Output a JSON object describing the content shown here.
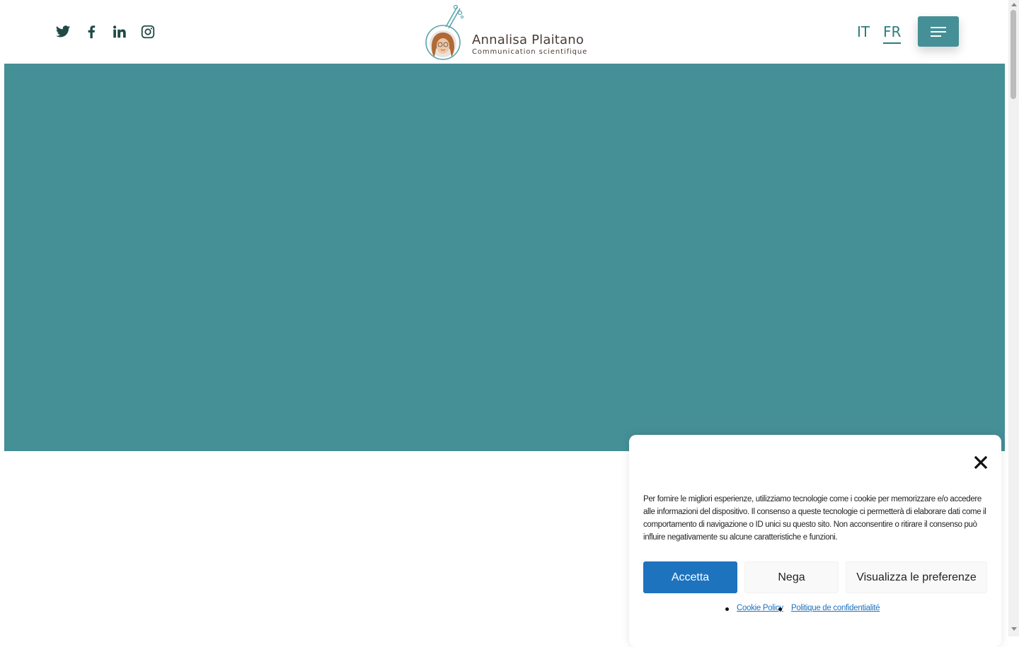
{
  "header": {
    "social": [
      {
        "icon": "twitter-icon"
      },
      {
        "icon": "facebook-icon"
      },
      {
        "icon": "linkedin-icon"
      },
      {
        "icon": "instagram-icon"
      }
    ],
    "logo": {
      "name": "Annalisa Plaitano",
      "tagline": "Communication scientifique"
    },
    "languages": [
      "IT",
      "FR"
    ],
    "active_language": "FR",
    "menu_icon": "hamburger-menu-icon"
  },
  "hero": {
    "background": "#458f96"
  },
  "cookie_banner": {
    "message": "Per fornire le migliori esperienze, utilizziamo tecnologie come i cookie per memorizzare e/o accedere alle informazioni del dispositivo. Il consenso a queste tecnologie ci permetterà di elaborare dati come il comportamento di navigazione o ID unici su questo sito. Non acconsentire o ritirare il consenso può influire negativamente su alcune caratteristiche e funzioni.",
    "accept_label": "Accetta",
    "deny_label": "Nega",
    "preferences_label": "Visualizza le preferenze",
    "links": [
      "Cookie Policy",
      "Politique de confidentialité"
    ],
    "close_icon": "close-icon"
  },
  "colors": {
    "brand_teal": "#458f96",
    "accept_blue": "#1e73be",
    "icon_dark": "#1f4a46"
  }
}
